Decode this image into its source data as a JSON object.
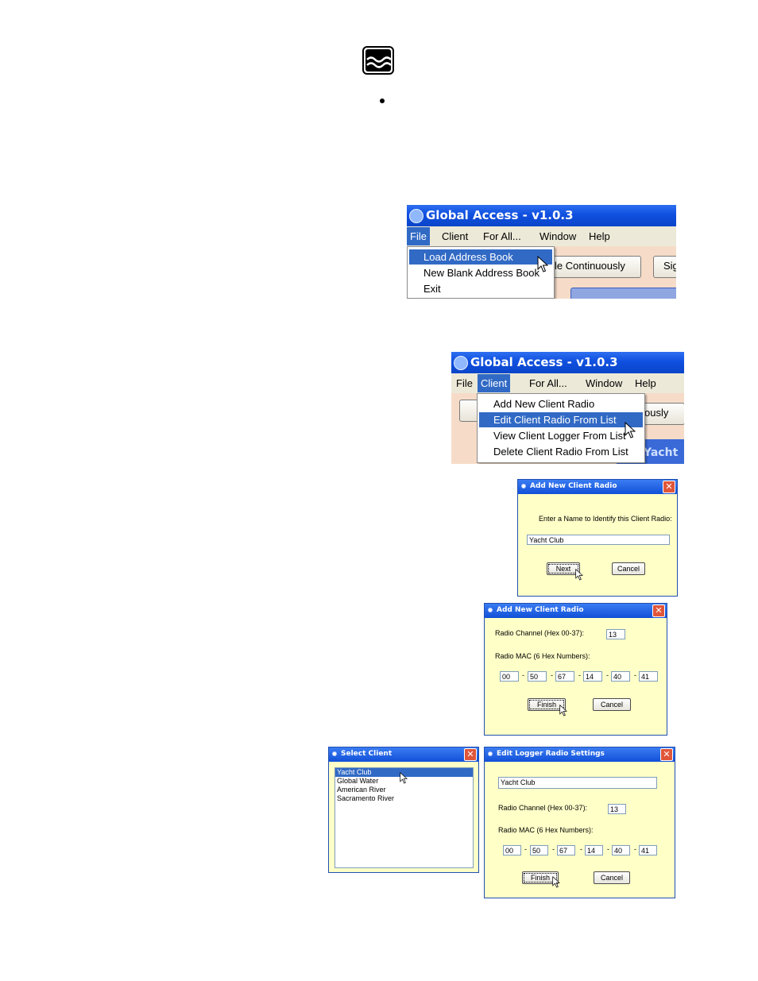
{
  "screen1": {
    "title": "Global Access - v1.0.3",
    "menu": [
      "File",
      "Client",
      "For All...",
      "Window",
      "Help"
    ],
    "file_menu": [
      "Load Address Book",
      "New Blank Address Book",
      "Exit"
    ],
    "bg_button_1": "le Continuously",
    "bg_button_2": "Sig"
  },
  "screen2": {
    "title": "Global Access - v1.0.3",
    "menu": [
      "File",
      "Client",
      "For All...",
      "Window",
      "Help"
    ],
    "client_menu": [
      "Add New Client Radio",
      "Edit Client Radio From List",
      "View Client Logger From List",
      "Delete Client Radio From List"
    ],
    "bg_button_1": "ously",
    "bg_tab": "Yacht C"
  },
  "dialog_name": {
    "title": "Add New Client Radio",
    "prompt": "Enter a Name to Identify this Client Radio:",
    "value": "Yacht Club",
    "next": "Next",
    "cancel": "Cancel"
  },
  "dialog_radio": {
    "title": "Add New Client Radio",
    "channel_label": "Radio Channel (Hex 00-37):",
    "channel": "13",
    "mac_label": "Radio MAC (6 Hex Numbers):",
    "mac": [
      "00",
      "50",
      "67",
      "14",
      "40",
      "41"
    ],
    "finish": "Finish",
    "cancel": "Cancel"
  },
  "dialog_select": {
    "title": "Select Client",
    "items": [
      "Yacht Club",
      "Global Water",
      "American River",
      "Sacramento River"
    ]
  },
  "dialog_edit": {
    "title": "Edit Logger Radio Settings",
    "name": "Yacht Club",
    "channel_label": "Radio Channel (Hex 00-37):",
    "channel": "13",
    "mac_label": "Radio MAC (6 Hex Numbers):",
    "mac": [
      "00",
      "50",
      "67",
      "14",
      "40",
      "41"
    ],
    "finish": "Finish",
    "cancel": "Cancel"
  },
  "icons": {
    "logo": "water-waves-icon",
    "cursor": "mouse-pointer-icon",
    "app": "global-access-app-icon",
    "close": "close-icon"
  },
  "colors": {
    "titlebar": "#0a45c8",
    "menu_highlight": "#316ac5",
    "dialog_bg": "#ffffc8",
    "workarea": "#f6dcc8"
  }
}
